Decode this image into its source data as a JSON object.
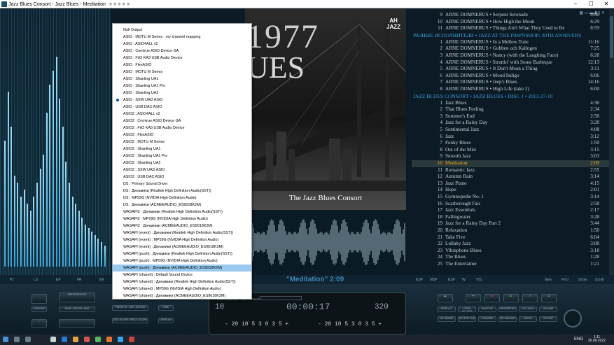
{
  "window": {
    "title": "Jazz Blues Consort - Jazz Blues - Meditation",
    "stars": "★★★★★",
    "min": "–",
    "max": "☐",
    "close": "✕"
  },
  "menu": {
    "items": [
      "Null Output",
      "ASIO : MOTU M Series - my channel mapping",
      "ASIO : ASIO4ALL v2",
      "ASIO : Comtrue ASIO Device GA",
      "ASIO : FiiO KA3 USB Audio Device",
      "ASIO : FlexASIO",
      "ASIO : MOTU M Series",
      "ASIO : Shanling UA1",
      "ASIO : Shanling UA1 Pro",
      "ASIO : Shanling UA2",
      "ASIO : SXW UAD ASIO",
      "ASIO : USB DAC ASIO",
      "ASIO2 : ASIO4ALL v2",
      "ASIO2 : Comtrue ASIO Device GA",
      "ASIO2 : FiiO KA3 USB Audio Device",
      "ASIO2 : FlexASIO",
      "ASIO2 : MOTU M Series",
      "ASIO2 : Shanling UA1",
      "ASIO2 : Shanling UA1 Pro",
      "ASIO2 : Shanling UA2",
      "ASIO2 : SXW UAD ASIO",
      "ASIO2 : USB DAC ASIO",
      "DS : Primary Sound Driver",
      "DS : Динамики (Realtek High Definition Audio(SST))",
      "DS : MP59G (NVIDIA High Definition Audio)",
      "DS : Динамики (ACMEEAUDIO_ES9018K2M)",
      "WASAPI2 : Динамики (Realtek High Definition Audio(SST))",
      "WASAPI2 : MP59G (NVIDIA High Definition Audio)",
      "WASAPI2 : Динамики (ACMEEAUDIO_ES9018K2M)",
      "WASAPI (event) : Динамики (Realtek High Definition Audio(SST))",
      "WASAPI (event) : MP59G (NVIDIA High Definition Audio)",
      "WASAPI (event) : Динамики (ACMEEAUDIO_ES9018K2M)",
      "WASAPI (push) : Динамики (Realtek High Definition Audio(SST))",
      "WASAPI (push) : MP59G (NVIDIA High Definition Audio)",
      "WASAPI (push) : Динамики (ACMEEAUDIO_ES9018K2M)",
      "WASAPI (shared) : Default Sound Device",
      "WASAPI (shared) : Динамики (Realtek High Definition Audio(SST))",
      "WASAPI (shared) : MP59G (NVIDIA High Definition Audio)",
      "WASAPI (shared) : Динамики (ACMEEAUDIO_ES9018K2M)"
    ],
    "checked_index": 10,
    "selected_index": 34
  },
  "album": {
    "big_title": "1977",
    "big_title2": "UES",
    "logo": "AH\nJAZZ",
    "caption": "The Jazz Blues Consort"
  },
  "playlist": {
    "top_rows": [
      {
        "n": "9",
        "t": "ARNE DOMNERUS • Serpent Serenade",
        "d": "0:00"
      },
      {
        "n": "10",
        "t": "ARNE DOMNERUS • How High the Moon",
        "d": "6:29"
      },
      {
        "n": "11",
        "t": "ARNE DOMNERUS • Things Ain't What They Used to Be",
        "d": "8:59"
      }
    ],
    "group1": "РАЗНЫЕ ИСПОЛНИТЕЛИ • JAZZ AT THE PAWNSHOP: 30TH ANNIVERS",
    "group1_rows": [
      {
        "n": "1",
        "t": "ARNE DOMNERUS • In a Mellow Tone",
        "d": "11:16"
      },
      {
        "n": "2",
        "t": "ARNE DOMNERUS • Gubben och Kalingen",
        "d": "7:25"
      },
      {
        "n": "3",
        "t": "ARNE DOMNERUS • Nancy (with the Laughing Face)",
        "d": "6:28"
      },
      {
        "n": "4",
        "t": "ARNE DOMNERUS • Struttin' with Some Barbeque",
        "d": "12:13"
      },
      {
        "n": "5",
        "t": "ARNE DOMNERUS • It Don't Mean a Thing",
        "d": "3:11"
      },
      {
        "n": "6",
        "t": "ARNE DOMNERUS • Mood Indigo",
        "d": "6:06"
      },
      {
        "n": "7",
        "t": "ARNE DOMNERUS • Jeep's Blues",
        "d": "14:16"
      },
      {
        "n": "8",
        "t": "ARNE DOMNERUS • High Life (take 2)",
        "d": "6:00"
      }
    ],
    "group2": "JAZZ BLUES CONSORT • JAZZ BLUES • DISC 1 • 2013-27-10",
    "group2_rows": [
      {
        "n": "1",
        "t": "Jazz Blues",
        "d": "4:36"
      },
      {
        "n": "2",
        "t": "That Blues Feeling",
        "d": "2:34"
      },
      {
        "n": "3",
        "t": "Summer's End",
        "d": "2:58"
      },
      {
        "n": "4",
        "t": "Jazz for a Rainy Day",
        "d": "3:28"
      },
      {
        "n": "5",
        "t": "Sentimental Jazz",
        "d": "4:08"
      },
      {
        "n": "6",
        "t": "Jazz",
        "d": "3:12"
      },
      {
        "n": "7",
        "t": "Funky Blues",
        "d": "1:50"
      },
      {
        "n": "8",
        "t": "Out of the Mist",
        "d": "3:15"
      },
      {
        "n": "9",
        "t": "Smooth Jazz",
        "d": "3:03"
      },
      {
        "n": "10",
        "t": "Meditation",
        "d": "2:09"
      },
      {
        "n": "11",
        "t": "Romantic Jazz",
        "d": "2:55"
      },
      {
        "n": "12",
        "t": "Autumn Rain",
        "d": "3:14"
      },
      {
        "n": "13",
        "t": "Jazz Piano",
        "d": "4:15"
      },
      {
        "n": "14",
        "t": "Hope",
        "d": "2:01"
      },
      {
        "n": "15",
        "t": "Gymnopedie No. 1",
        "d": "3:14"
      },
      {
        "n": "16",
        "t": "Scarborough Fair",
        "d": "2:58"
      },
      {
        "n": "17",
        "t": "Jazz Essentials",
        "d": "2:17"
      },
      {
        "n": "18",
        "t": "Fallingwater",
        "d": "3:28"
      },
      {
        "n": "19",
        "t": "Jazz for a Rainy Day Part 2",
        "d": "3:44"
      },
      {
        "n": "20",
        "t": "Relaxation",
        "d": "1:50"
      },
      {
        "n": "21",
        "t": "Take Five",
        "d": "6:04"
      },
      {
        "n": "22",
        "t": "Lullaby Jazz",
        "d": "3:08"
      },
      {
        "n": "23",
        "t": "Vibraphone Blues",
        "d": "3:18"
      },
      {
        "n": "24",
        "t": "The Blues",
        "d": "1:28"
      },
      {
        "n": "25",
        "t": "The Entertainer",
        "d": "1:21"
      }
    ],
    "playing_index": 9
  },
  "tabs": {
    "left": [
      "P1",
      "LS",
      "EP",
      "FR",
      "BK"
    ],
    "now_playing": "\"Meditation\" 2:09",
    "mid": [
      "ESP",
      "MSP",
      "ESP",
      "W",
      "VIS"
    ],
    "right": [
      "New",
      "Find",
      "Show",
      "Scroll"
    ]
  },
  "analyzer": {
    "labels": [
      "12",
      "DB",
      "P5",
      "P54",
      "P53",
      "P52",
      "P31"
    ]
  },
  "controls": {
    "left_btns": [
      "PREFERENCES",
      "CONSOLE",
      "PANE -STATUS- BAR",
      "PRESETS - DSP - ACTIVE",
      "TIME",
      "DSC-SCOPE SPECT-SCOPE",
      "DISPLAY"
    ],
    "right_btns": [
      "STOP A.T.",
      "OPEN FOLDER",
      "SHUFFLE",
      "PROPERTIES",
      "VOL 100%",
      "VOLUME",
      "CD ORDER",
      "DELETE FILE",
      "CONVERT",
      "MK SUSTAIN",
      "M.BOX",
      "ON TOP"
    ],
    "lcd_track": "10",
    "lcd_time": "00:00:17",
    "lcd_bitrate": "320",
    "lcd_labels": "TRACK  ELAPSED  TIME  BITRATE",
    "vu_scale": "- 20 10  5 3  0  3 5 +"
  },
  "taskbar": {
    "lang": "ENG",
    "time": "1:11",
    "date": "26.06.2022"
  }
}
